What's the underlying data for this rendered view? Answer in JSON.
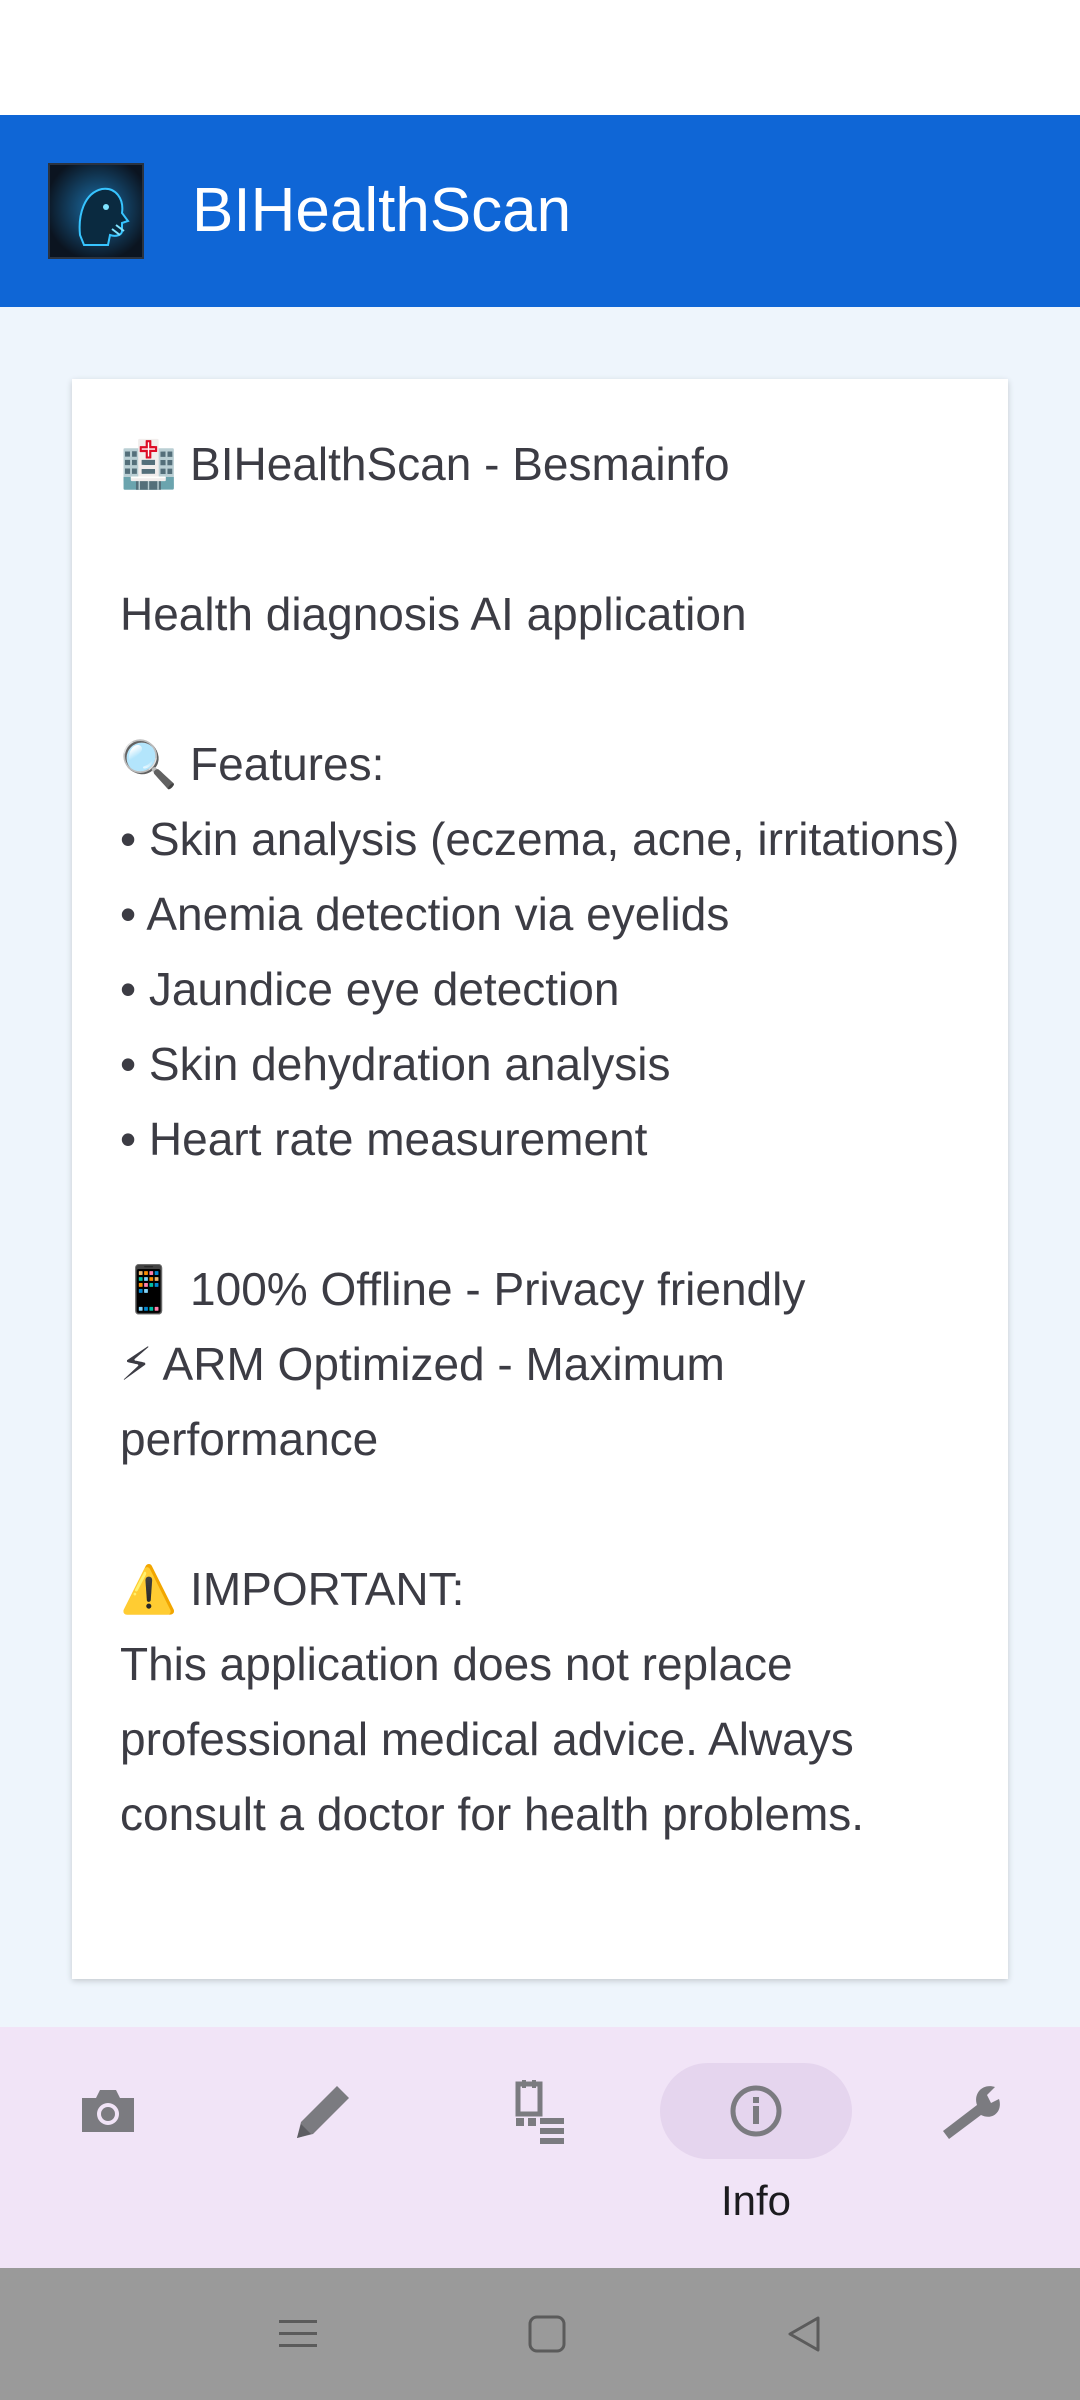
{
  "app_bar": {
    "title": "BIHealthScan"
  },
  "card": {
    "text": "🏥 BIHealthScan - Besmainfo\n\nHealth diagnosis AI application\n\n🔍 Features:\n• Skin analysis (eczema, acne, irritations)\n• Anemia detection via eyelids\n• Jaundice eye detection\n• Skin dehydration analysis\n• Heart rate measurement\n\n📱 100% Offline - Privacy friendly\n⚡ ARM Optimized - Maximum performance\n\n⚠️ IMPORTANT:\nThis application does not replace professional medical advice. Always consult a doctor for health problems."
  },
  "bottom_nav": {
    "items": [
      {
        "icon": "camera-icon",
        "label": ""
      },
      {
        "icon": "pencil-icon",
        "label": ""
      },
      {
        "icon": "history-list-icon",
        "label": ""
      },
      {
        "icon": "info-icon",
        "label": "Info",
        "active": true
      },
      {
        "icon": "wrench-icon",
        "label": ""
      }
    ]
  },
  "colors": {
    "app_bar": "#0f66d6",
    "content_bg": "#eef5fc",
    "nav_bg": "#f1e4f7",
    "nav_active_pill": "#e5d5ee",
    "icon_gray": "#7b7b80",
    "system_nav_bg": "#9a9a9a"
  },
  "system_nav": {
    "buttons": [
      "menu-icon",
      "home-icon",
      "back-icon"
    ]
  }
}
